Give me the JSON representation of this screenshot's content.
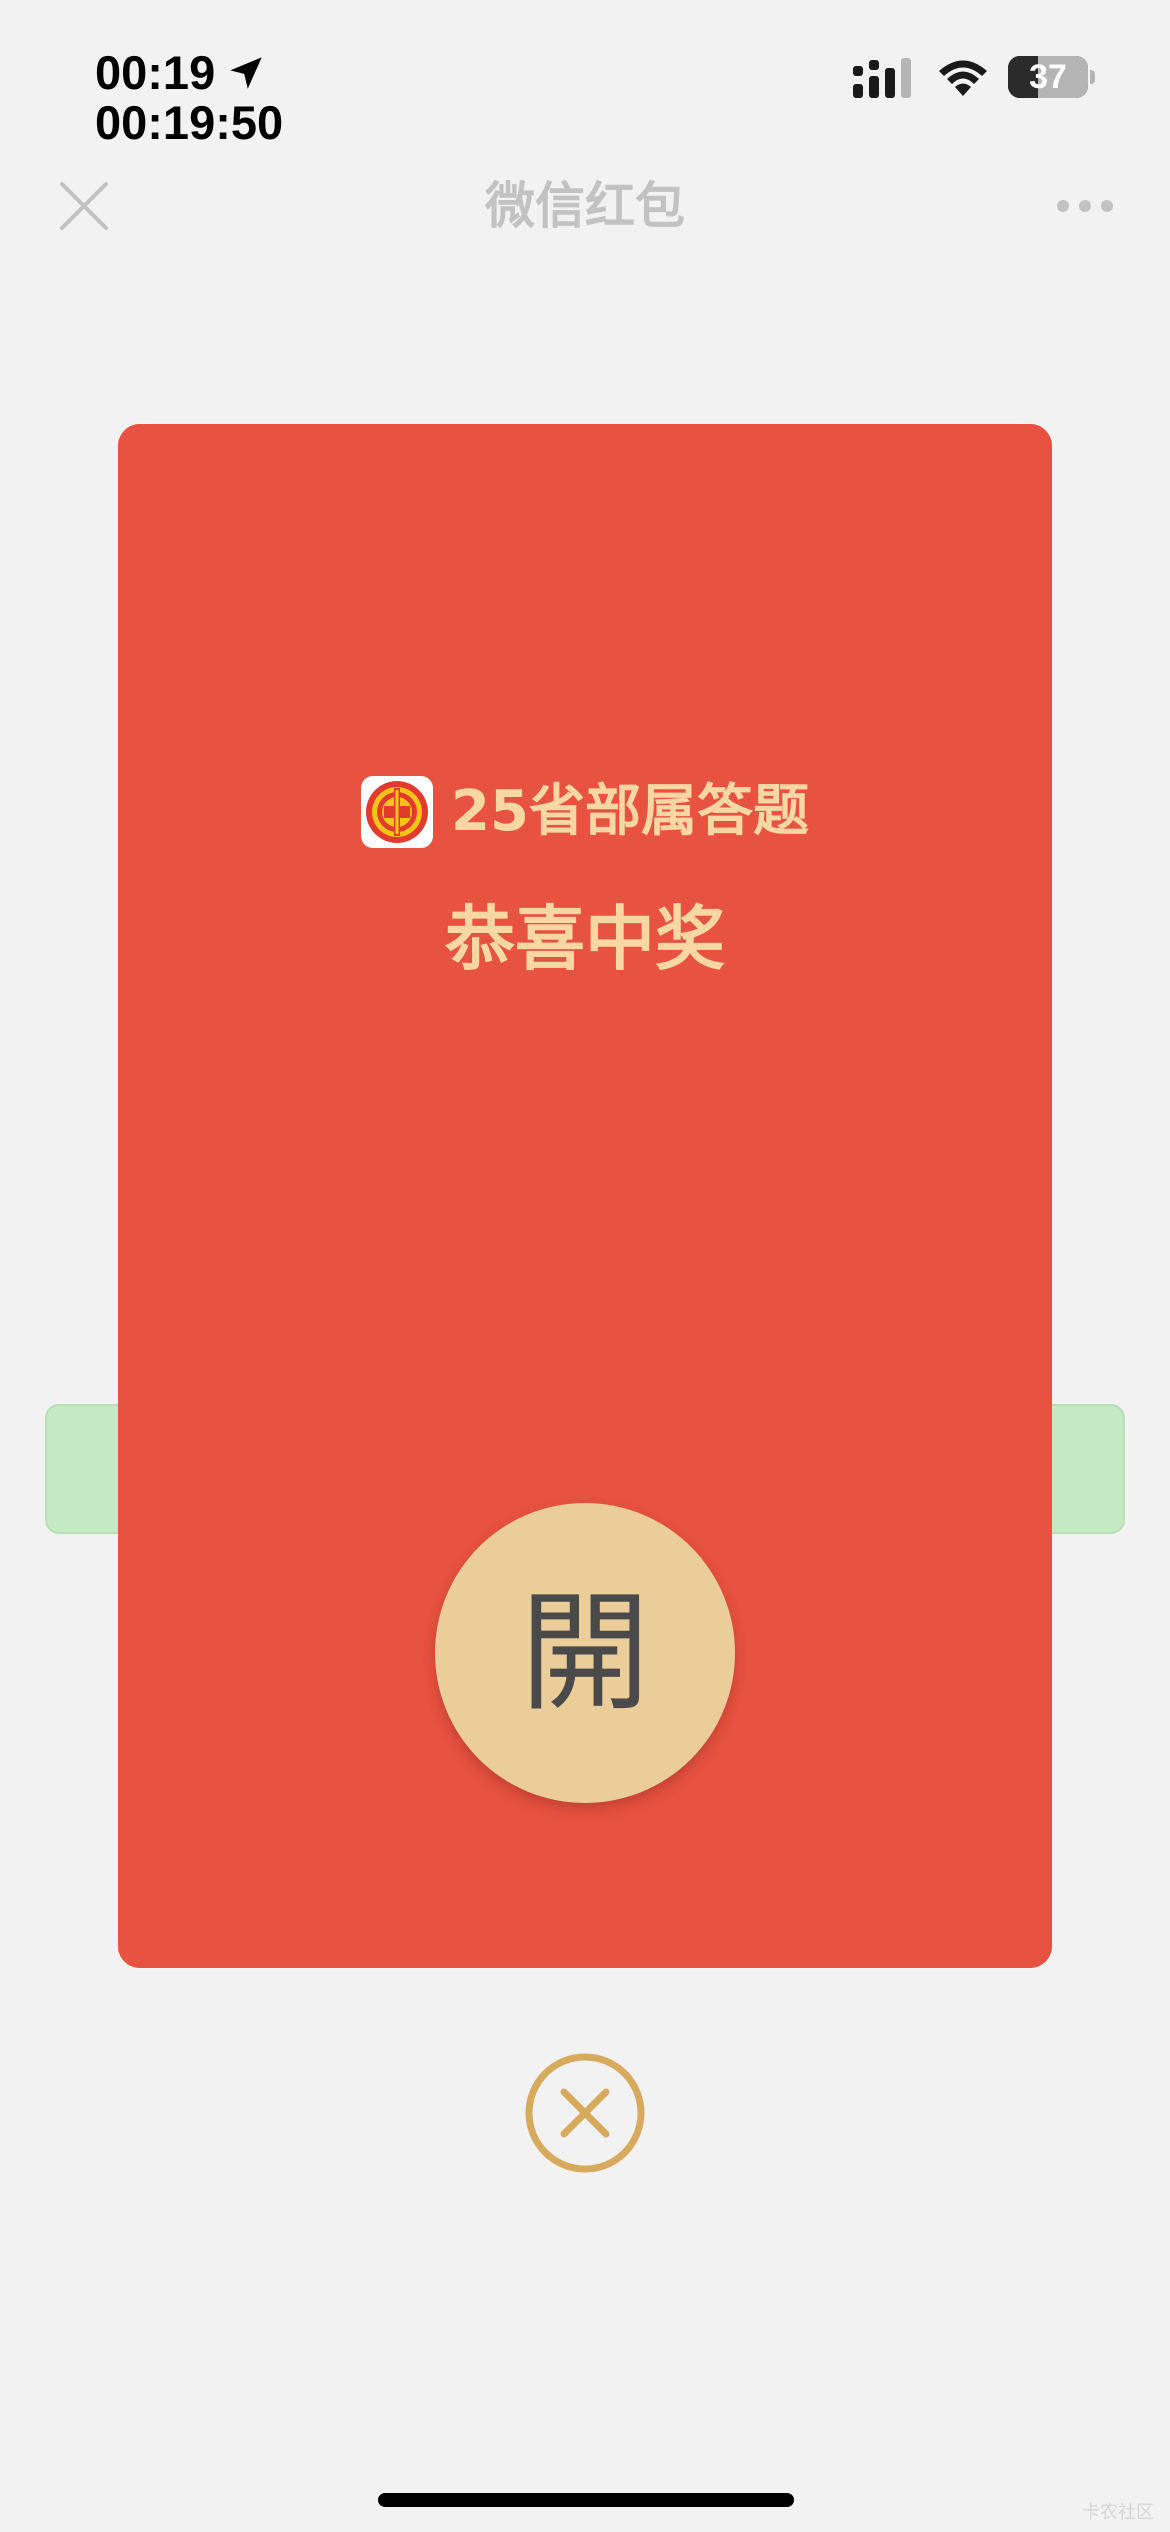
{
  "status_bar": {
    "time": "00:19",
    "time_seconds": "00:19:50",
    "battery_level": "37",
    "battery_fraction": 0.37,
    "icons": [
      "location-arrow-icon",
      "cellular-signal-icon",
      "wifi-icon",
      "battery-icon"
    ]
  },
  "nav": {
    "title": "微信红包",
    "close_icon": "close-icon",
    "more_icon": "more-dots-icon"
  },
  "envelope": {
    "sender_name": "25省部属答题",
    "greeting": "恭喜中奖",
    "open_label": "開",
    "colors": {
      "body": "#f25443",
      "flap": "#e85240",
      "text": "#f8d7a3",
      "button": "#ebcd9a"
    }
  },
  "dismiss": {
    "icon": "close-circle-icon",
    "color": "#d8aa5e"
  },
  "watermark": "卡农社区"
}
